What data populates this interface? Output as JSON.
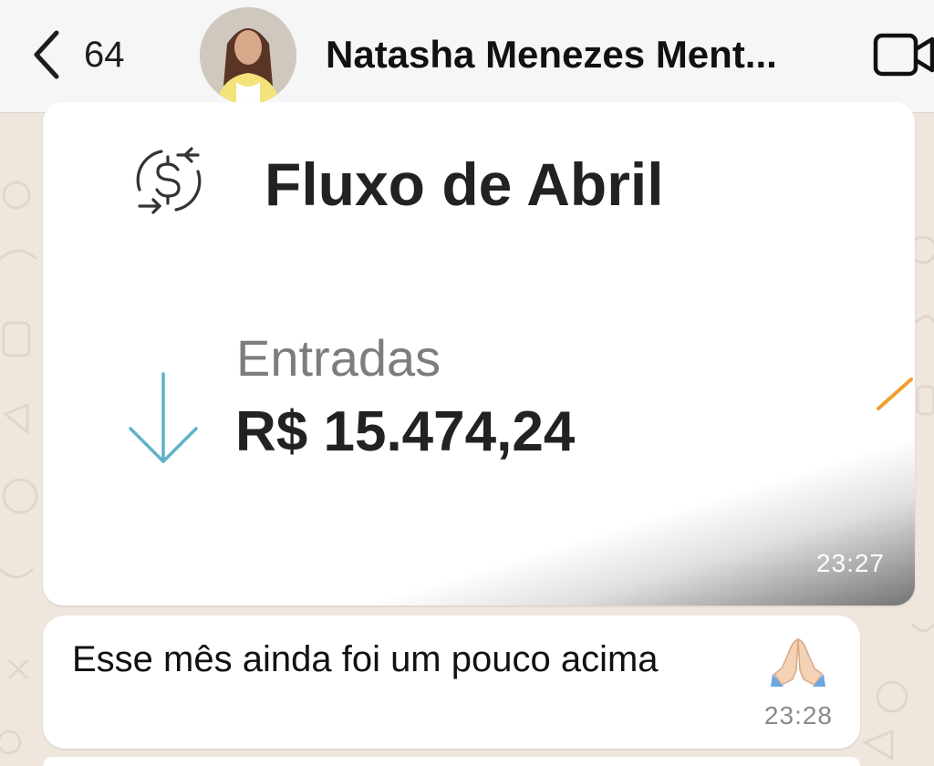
{
  "header": {
    "back_count": "64",
    "contact_name": "Natasha Menezes Ment..."
  },
  "icons": {
    "back": "chevron-left-icon",
    "video": "video-camera-icon",
    "money_flow": "dollar-cycle-icon",
    "incoming": "arrow-down-icon",
    "pray": "folded-hands-emoji"
  },
  "messages": [
    {
      "type": "image",
      "image_content": {
        "title": "Fluxo de Abril",
        "label": "Entradas",
        "value": "R$ 15.474,24"
      },
      "time": "23:27"
    },
    {
      "type": "text",
      "text": "Esse mês ainda foi um pouco acima",
      "emoji": "🙏🏻",
      "time": "23:28"
    }
  ],
  "colors": {
    "chat_background": "#efe7de",
    "header_background": "#f6f6f6",
    "bubble": "#ffffff",
    "arrow_accent": "#5fb2c9",
    "orange_accent": "#f0a030"
  }
}
